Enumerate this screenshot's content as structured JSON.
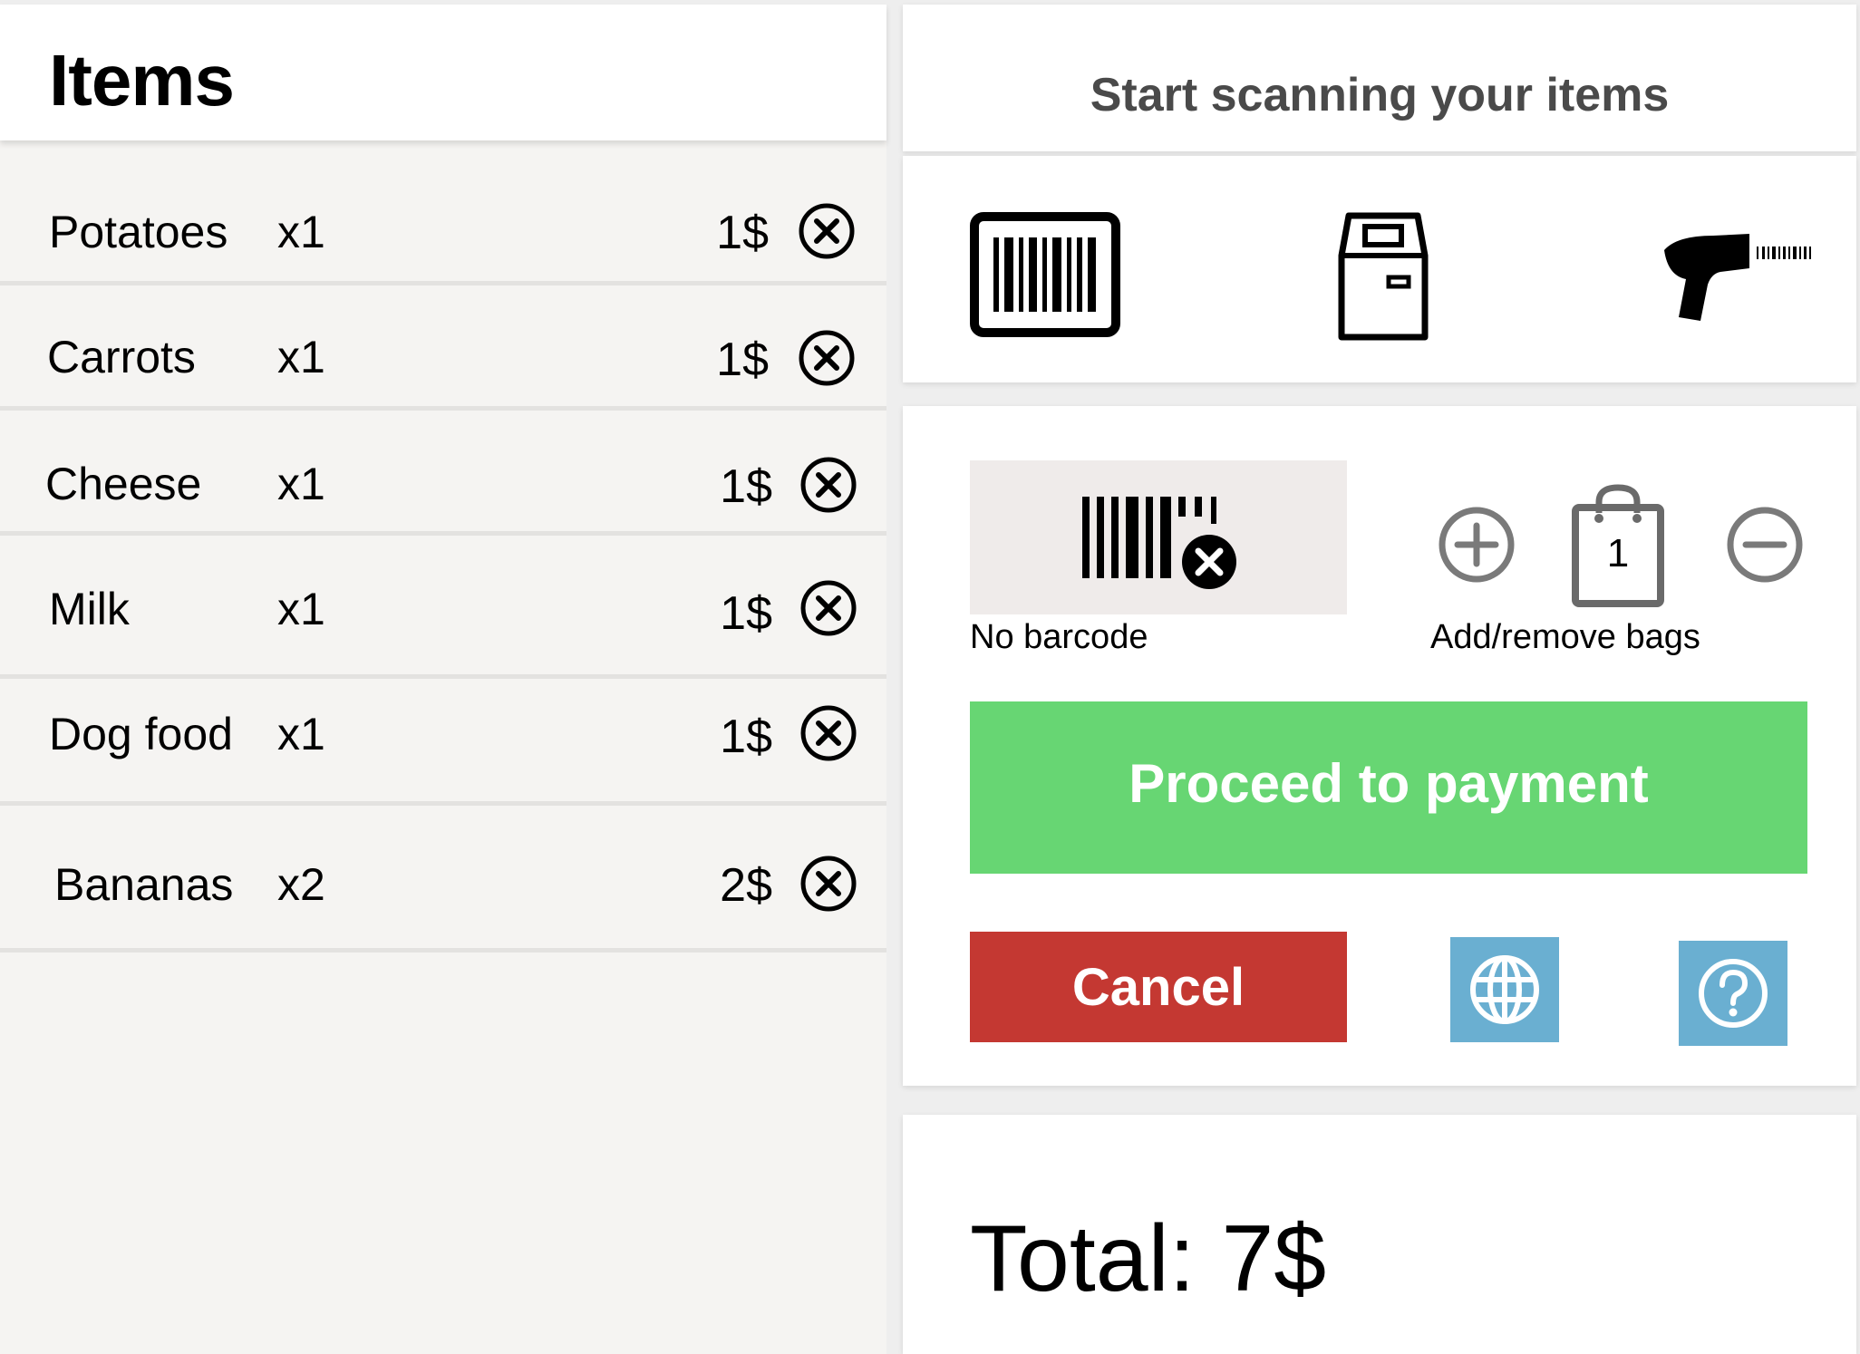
{
  "items_panel": {
    "title": "Items",
    "items": [
      {
        "name": "Potatoes",
        "qty": "x1",
        "price": "1$"
      },
      {
        "name": "Carrots",
        "qty": "x1",
        "price": "1$"
      },
      {
        "name": "Cheese",
        "qty": "x1",
        "price": "1$"
      },
      {
        "name": "Milk",
        "qty": "x1",
        "price": "1$"
      },
      {
        "name": "Dog food",
        "qty": "x1",
        "price": "1$"
      },
      {
        "name": "Bananas",
        "qty": "x2",
        "price": "2$"
      }
    ]
  },
  "scan_panel": {
    "title": "Start scanning your items",
    "icons": [
      "barcode-icon",
      "scale-kiosk-icon",
      "barcode-scanner-icon"
    ]
  },
  "actions": {
    "no_barcode_label": "No barcode",
    "bags_label": "Add/remove bags",
    "bag_count": "1",
    "pay_label": "Proceed to payment",
    "cancel_label": "Cancel",
    "language_icon": "globe-icon",
    "help_icon": "help-icon"
  },
  "total": {
    "label": "Total: 7$"
  },
  "colors": {
    "pay_green": "#67d673",
    "cancel_red": "#c43832",
    "icon_blue": "#6aafd1",
    "panel_bg": "#f5f4f2"
  }
}
